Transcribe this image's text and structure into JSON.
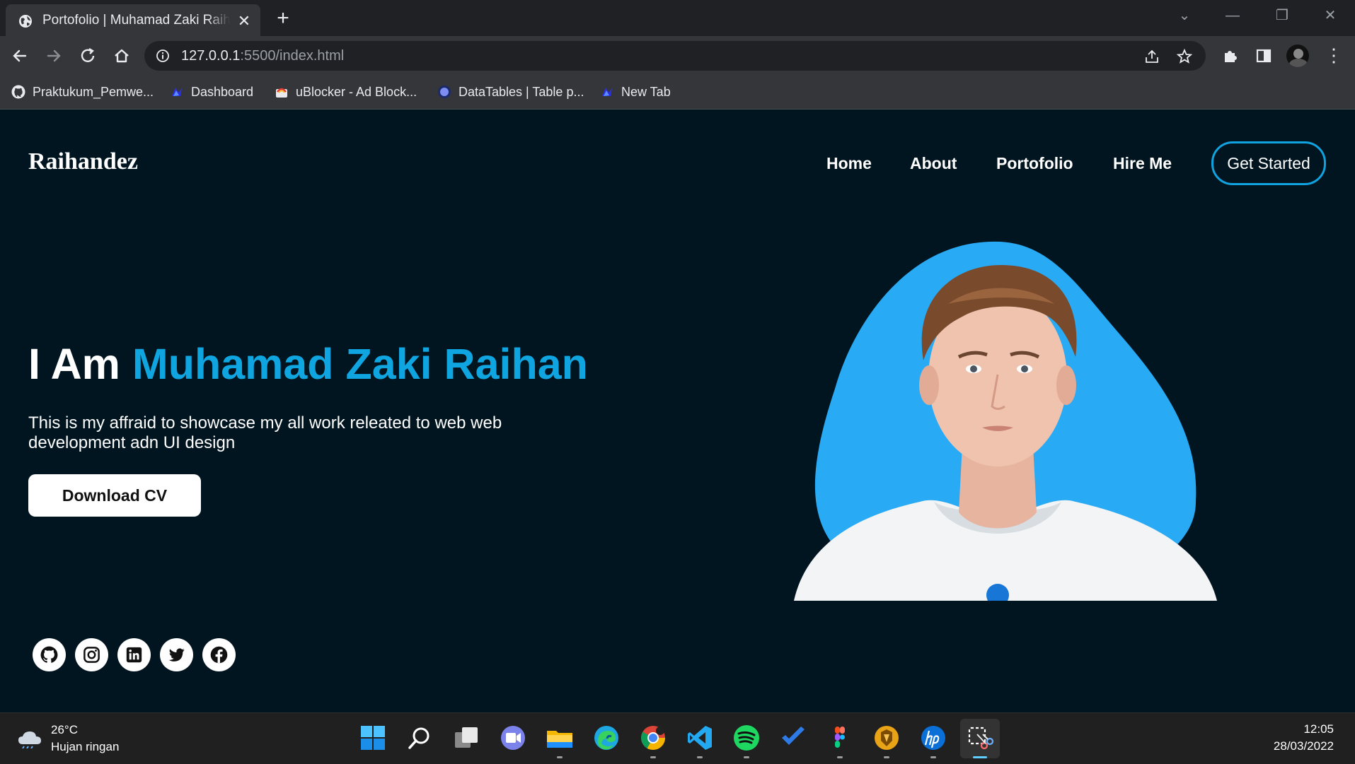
{
  "browser": {
    "tab_title": "Portofolio | Muhamad Zaki Raihan",
    "url_host": "127.0.0.1",
    "url_rest": ":5500/index.html",
    "bookmarks": [
      {
        "label": "Praktukum_Pemwe...",
        "icon": "github-icon"
      },
      {
        "label": "Dashboard",
        "icon": "app-icon"
      },
      {
        "label": "uBlocker - Ad Block...",
        "icon": "ublocker-icon"
      },
      {
        "label": "DataTables | Table p...",
        "icon": "datatables-icon"
      },
      {
        "label": "New Tab",
        "icon": "app-icon"
      }
    ]
  },
  "site": {
    "logo": "Raihandez",
    "nav": [
      "Home",
      "About",
      "Portofolio",
      "Hire Me"
    ],
    "cta": "Get Started",
    "hero_prefix": "I Am ",
    "hero_name": "Muhamad Zaki Raihan",
    "description": "This is my affraid to showcase my all work releated to web web development adn UI design",
    "download_button": "Download CV",
    "socials": [
      "github-icon",
      "instagram-icon",
      "linkedin-icon",
      "twitter-icon",
      "facebook-icon"
    ],
    "colors": {
      "background": "#011520",
      "accent": "#0ea5e0",
      "blob": "#29aaf5"
    }
  },
  "taskbar": {
    "temperature": "26°C",
    "weather": "Hujan ringan",
    "time": "12:05",
    "date": "28/03/2022",
    "apps": [
      "start",
      "search",
      "task-view",
      "teams",
      "file-explorer",
      "edge",
      "chrome",
      "vscode",
      "spotify",
      "todo",
      "figma",
      "app",
      "hp",
      "snipping-tool"
    ]
  }
}
